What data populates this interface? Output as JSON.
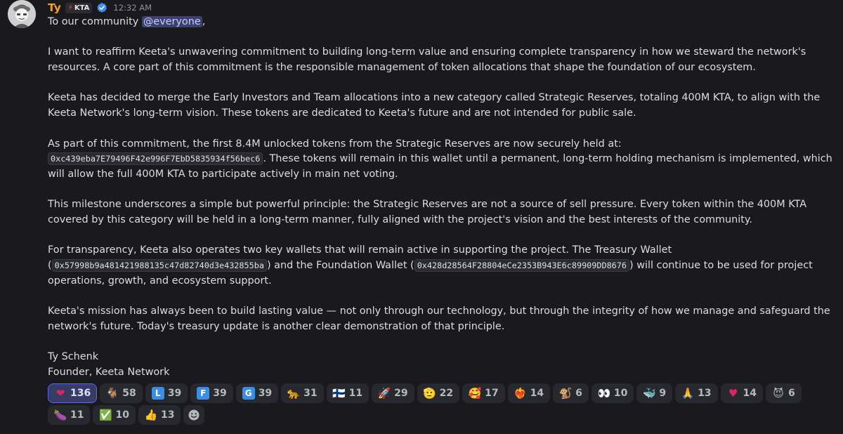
{
  "author": {
    "name": "Ty",
    "tag": "KTA",
    "timestamp": "12:32 AM"
  },
  "message": {
    "intro": "To our community ",
    "mention": "@everyone",
    "intro_end": ",",
    "p1": "I want to reaffirm Keeta's unwavering commitment to building long-term value and ensuring complete transparency in how we steward the network's resources. A core part of this commitment is the responsible management of token allocations that shape the foundation of our ecosystem.",
    "p2": "Keeta has decided to merge the Early Investors and Team allocations into a new category called Strategic Reserves, totaling 400M KTA, to align with the Keeta Network's long-term vision. These tokens are dedicated to Keeta's future and are not intended for public sale.",
    "p3_a": "As part of this commitment, the first 8.4M unlocked tokens from the Strategic Reserves are now securely held at: ",
    "p3_addr": "0xc439eba7E79496F42e996F7EbD5835934f56bec6",
    "p3_b": ". These tokens will remain in this wallet until a permanent, long-term holding mechanism is implemented, which will allow the full 400M KTA to participate actively in main net voting.",
    "p4": "This milestone underscores a simple but powerful principle: the Strategic Reserves are not a source of sell pressure. Every token within the 400M KTA covered by this category will be held in a long-term manner, fully aligned with the project's vision and the best interests of the community.",
    "p5_a": "For transparency, Keeta also operates two key wallets that will remain active in supporting the project. The Treasury Wallet (",
    "p5_addr1": "0x57998b9a481421988135c47d82740d3e432855ba",
    "p5_b": ") and the Foundation Wallet (",
    "p5_addr2": "0x428d28564F28804eCe2353B943E6c89909DD8676",
    "p5_c": ") will continue to be used for project operations, growth, and ecosystem support.",
    "p6": "Keeta's mission has always been to build lasting value — not only through our technology, but through the integrity of how we manage and safeguard the network's future. Today's treasury update is another clear demonstration of that principle.",
    "sig_name": "Ty Schenk",
    "sig_title": "Founder, Keeta Network"
  },
  "reactions": [
    {
      "emoji": "❤",
      "count": "136",
      "active": true,
      "color": "#e0245e"
    },
    {
      "emoji": "🐐",
      "count": "58"
    },
    {
      "emoji": "L",
      "count": "39",
      "box": "#3a8ee6"
    },
    {
      "emoji": "F",
      "count": "39",
      "box": "#3a8ee6"
    },
    {
      "emoji": "G",
      "count": "39",
      "box": "#3a8ee6"
    },
    {
      "emoji": "🐆",
      "count": "31"
    },
    {
      "emoji": "🇫🇮",
      "count": "11"
    },
    {
      "emoji": "🚀",
      "count": "29"
    },
    {
      "emoji": "🫡",
      "count": "22"
    },
    {
      "emoji": "🥰",
      "count": "17"
    },
    {
      "emoji": "❤‍🔥",
      "count": "14"
    },
    {
      "emoji": "🐒",
      "count": "6"
    },
    {
      "emoji": "👀",
      "count": "10"
    },
    {
      "emoji": "🐳",
      "count": "9"
    },
    {
      "emoji": "🙏",
      "count": "13"
    },
    {
      "emoji": "♥",
      "count": "14",
      "color": "#e0245e"
    },
    {
      "emoji": "😈",
      "count": "6"
    },
    {
      "emoji": "🍆",
      "count": "11"
    },
    {
      "emoji": "✅",
      "count": "10"
    },
    {
      "emoji": "👍",
      "count": "13"
    }
  ]
}
